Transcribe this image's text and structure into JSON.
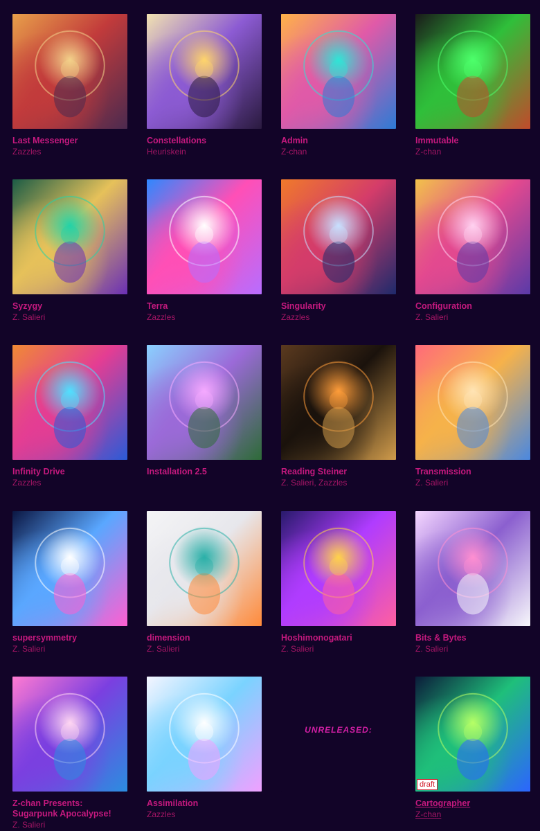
{
  "tiles": [
    {
      "title": "Last Messenger",
      "artist": "Zazzles",
      "colors": [
        "#e8a04a",
        "#c23b3b",
        "#4b2a4f"
      ],
      "accent": "#f3d28a"
    },
    {
      "title": "Constellations",
      "artist": "Heuriskein",
      "colors": [
        "#f2e3b0",
        "#8c5bd3",
        "#2a1a3f"
      ],
      "accent": "#ffd56b"
    },
    {
      "title": "Admin",
      "artist": "Z-chan",
      "colors": [
        "#ffb347",
        "#e05aa8",
        "#2d7bd5"
      ],
      "accent": "#2ee6d6"
    },
    {
      "title": "Immutable",
      "artist": "Z-chan",
      "colors": [
        "#1a1a1a",
        "#2fbf3a",
        "#c14a2b"
      ],
      "accent": "#4dff6b"
    },
    {
      "title": "Syzygy",
      "artist": "Z. Salieri",
      "colors": [
        "#1b5c46",
        "#e6c15a",
        "#6a2fb5"
      ],
      "accent": "#22d3a8"
    },
    {
      "title": "Terra",
      "artist": "Zazzles",
      "colors": [
        "#2e88ff",
        "#ff4fb6",
        "#b76dff"
      ],
      "accent": "#ffffff"
    },
    {
      "title": "Singularity",
      "artist": "Zazzles",
      "colors": [
        "#f07a2a",
        "#d43c6a",
        "#1e2a6b"
      ],
      "accent": "#c7e0ff"
    },
    {
      "title": "Configuration",
      "artist": "Z. Salieri",
      "colors": [
        "#f2c24a",
        "#e3498f",
        "#5a3aa8"
      ],
      "accent": "#ffd1f0"
    },
    {
      "title": "Infinity Drive",
      "artist": "Zazzles",
      "colors": [
        "#f08a34",
        "#e43d93",
        "#2a5bd7"
      ],
      "accent": "#4fe0ff"
    },
    {
      "title": "Installation 2.5",
      "artist": "",
      "colors": [
        "#8ad1ff",
        "#9b6ad8",
        "#2d6b37"
      ],
      "accent": "#f5a9ff"
    },
    {
      "title": "Reading Steiner",
      "artist": "Z. Salieri, Zazzles",
      "colors": [
        "#5b3a1f",
        "#1a120c",
        "#d09b4b"
      ],
      "accent": "#ff9d3a"
    },
    {
      "title": "Transmission",
      "artist": "Z. Salieri",
      "colors": [
        "#ff6a7a",
        "#f6b24a",
        "#4a88e0"
      ],
      "accent": "#ffe4b5"
    },
    {
      "title": "supersymmetry",
      "artist": "Z. Salieri",
      "colors": [
        "#0b1642",
        "#5aa7ff",
        "#ff5fd1"
      ],
      "accent": "#ffffff"
    },
    {
      "title": "dimension",
      "artist": "Z. Salieri",
      "colors": [
        "#f4f4f6",
        "#e7e7ec",
        "#ff8a3a"
      ],
      "accent": "#2ab0a8"
    },
    {
      "title": "Hoshimonogatari",
      "artist": "Z. Salieri",
      "colors": [
        "#281a6b",
        "#b03cff",
        "#ff5fa0"
      ],
      "accent": "#ffd24a"
    },
    {
      "title": "Bits & Bytes",
      "artist": "Z. Salieri",
      "colors": [
        "#f5d7ff",
        "#8b5fcf",
        "#f7f7fb"
      ],
      "accent": "#ff8fd1"
    },
    {
      "title": "Z-chan Presents: Sugarpunk Apocalypse!",
      "artist": "Z. Salieri",
      "colors": [
        "#ff7bd1",
        "#7b3fe0",
        "#2b8de0"
      ],
      "accent": "#ffd6f2"
    },
    {
      "title": "Assimilation",
      "artist": "Zazzles",
      "colors": [
        "#f5f5ff",
        "#7ad3ff",
        "#f0a0ff"
      ],
      "accent": "#ffffff"
    },
    {
      "title": "",
      "artist": "",
      "unreleased": true,
      "unreleased_label": "UNRELEASED:",
      "colors": [
        "#120428",
        "#120428",
        "#120428"
      ],
      "accent": "#d21fa5"
    },
    {
      "title": "Cartographer",
      "artist": "Z-chan",
      "draft": true,
      "draft_label": "draft",
      "colors": [
        "#0b1b3a",
        "#1fbf7a",
        "#2c65ff"
      ],
      "accent": "#b6ff66"
    }
  ]
}
